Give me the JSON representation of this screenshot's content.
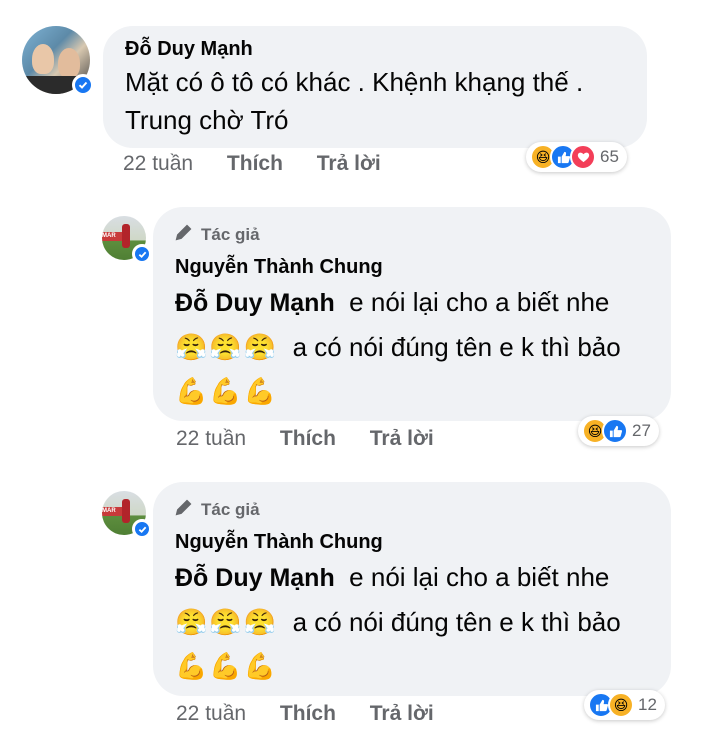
{
  "comments": [
    {
      "author": "Đỗ Duy Mạnh",
      "lines": [
        "Mặt có ô tô có khác . Khệnh khạng thế .",
        "Trung chờ Tró"
      ],
      "time": "22 tuần",
      "like_label": "Thích",
      "reply_label": "Trả lời",
      "reaction_count": "65",
      "reaction_icons": [
        "haha-icon",
        "like-icon",
        "love-icon"
      ]
    },
    {
      "author_tag": "Tác giả",
      "author": "Nguyễn Thành Chung",
      "mention": "Đỗ Duy Mạnh",
      "line1_rest": "e nói lại cho a biết nhe",
      "line2_emojis": "😤😤😤",
      "line2_text": "a có nói đúng tên e k thì bảo",
      "line3_emojis": "💪💪💪",
      "time": "22 tuần",
      "like_label": "Thích",
      "reply_label": "Trả lời",
      "reaction_count": "27",
      "reaction_icons": [
        "haha-icon",
        "like-icon"
      ]
    },
    {
      "author_tag": "Tác giả",
      "author": "Nguyễn Thành Chung",
      "mention": "Đỗ Duy Mạnh",
      "line1_rest": "e nói lại cho a biết nhe",
      "line2_emojis": "😤😤😤",
      "line2_text": "a có nói đúng tên e k thì bảo",
      "line3_emojis": "💪💪💪",
      "time": "22 tuần",
      "like_label": "Thích",
      "reply_label": "Trả lời",
      "reaction_count": "12",
      "reaction_icons": [
        "like-icon",
        "haha-icon"
      ]
    }
  ],
  "colors": {
    "bubble": "#f0f2f5",
    "meta_text": "#65676b",
    "like_blue": "#1877f2",
    "haha_yellow": "#f7b125",
    "love_red": "#f33e58"
  }
}
